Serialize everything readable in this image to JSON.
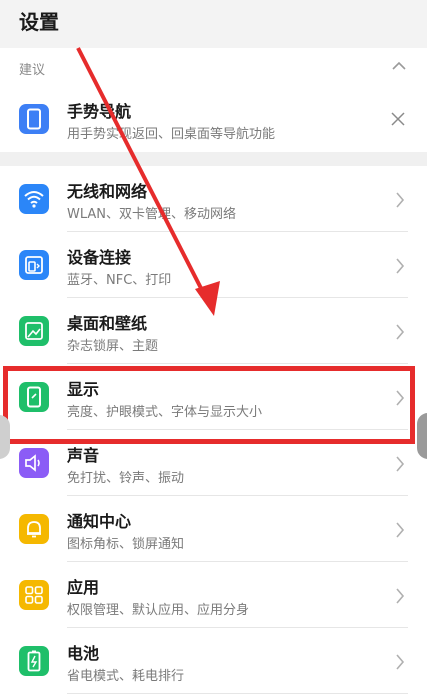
{
  "header": {
    "title": "设置"
  },
  "suggestions": {
    "label": "建议",
    "collapse_icon": "chevron-up-icon",
    "item": {
      "title": "手势导航",
      "subtitle": "用手势实现返回、回桌面等导航功能",
      "icon": "phone-gesture-icon",
      "color": "#3d7ff5"
    }
  },
  "items": [
    {
      "title": "无线和网络",
      "subtitle": "WLAN、双卡管理、移动网络",
      "icon": "wifi-icon",
      "color": "#2b86f8"
    },
    {
      "title": "设备连接",
      "subtitle": "蓝牙、NFC、打印",
      "icon": "device-connect-icon",
      "color": "#2b86f8"
    },
    {
      "title": "桌面和壁纸",
      "subtitle": "杂志锁屏、主题",
      "icon": "wallpaper-icon",
      "color": "#1fbf6a"
    },
    {
      "title": "显示",
      "subtitle": "亮度、护眼模式、字体与显示大小",
      "icon": "display-icon",
      "color": "#1fbf6a"
    },
    {
      "title": "声音",
      "subtitle": "免打扰、铃声、振动",
      "icon": "sound-icon",
      "color": "#8b5cf6"
    },
    {
      "title": "通知中心",
      "subtitle": "图标角标、锁屏通知",
      "icon": "bell-icon",
      "color": "#f5b800"
    },
    {
      "title": "应用",
      "subtitle": "权限管理、默认应用、应用分身",
      "icon": "apps-icon",
      "color": "#f5b800"
    },
    {
      "title": "电池",
      "subtitle": "省电模式、耗电排行",
      "icon": "battery-icon",
      "color": "#1fbf6a"
    }
  ],
  "annotation": {
    "highlight_color": "#e62c2c"
  }
}
